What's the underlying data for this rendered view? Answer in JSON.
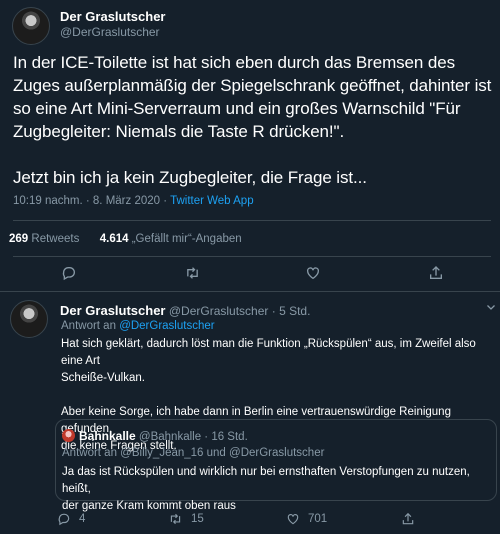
{
  "tweet": {
    "author_name": "Der Graslutscher",
    "author_handle": "@DerGraslutscher",
    "line1": "In der ICE-Toilette ist hat sich eben durch das Bremsen des",
    "line2": "Zuges außerplanmäßig der Spiegelschrank geöffnet, dahinter ist",
    "line3": "so eine Art Mini-Serverraum und ein großes Warnschild \"Für",
    "line4": "Zugbegleiter: Niemals die Taste R drücken!\".",
    "line5": "Jetzt bin ich ja kein Zugbegleiter, die Frage ist...",
    "timestamp": "10:19 nachm. · 8. März 2020 ·",
    "source": "Twitter Web App",
    "retweet_count": "269",
    "retweet_label": "Retweets",
    "like_count": "4.614",
    "like_label": "„Gefällt mir“-Angaben"
  },
  "reply": {
    "author_name": "Der Graslutscher",
    "author_handle": "@DerGraslutscher",
    "time": "· 5 Std.",
    "replying_to_label": "Antwort an",
    "replying_to_handle": "@DerGraslutscher",
    "line1": "Hat sich geklärt, dadurch löst man die Funktion „Rückspülen“ aus, im Zweifel also eine Art",
    "line2": "Scheiße-Vulkan.",
    "line3": "Aber keine Sorge, ich habe dann in Berlin eine vertrauenswürdige Reinigung gefunden,",
    "line4": "die keine Fragen stellt.",
    "reply_count": "4",
    "retweet_count": "15",
    "like_count": "701"
  },
  "quote": {
    "author_name": "Bahnkalle",
    "author_handle": "@Bahnkalle",
    "time": "· 16 Std.",
    "replying_to": "Antwort an @Billy_Jean_16 und @DerGraslutscher",
    "line1": "Ja das ist Rückspülen und wirklich nur bei ernsthaften Verstopfungen zu nutzen, heißt,",
    "line2": "der ganze Kram kommt oben raus"
  },
  "colors": {
    "background": "#15202b",
    "accent": "#1da1f2",
    "muted": "#8899a6",
    "divider": "#38444d"
  },
  "icons": [
    "reply-icon",
    "retweet-icon",
    "like-icon",
    "share-icon",
    "chevron-down-icon"
  ]
}
